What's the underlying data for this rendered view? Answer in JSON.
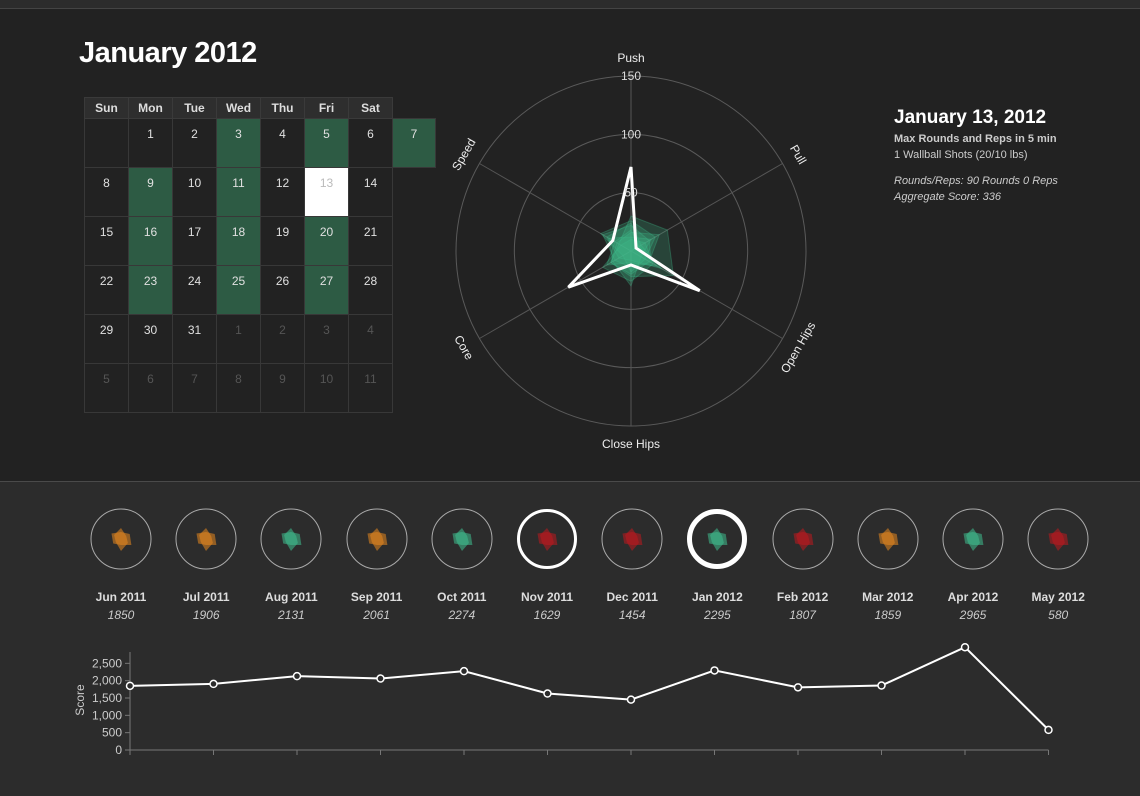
{
  "calendar": {
    "title": "January 2012",
    "weekdays": [
      "Sun",
      "Mon",
      "Tue",
      "Wed",
      "Thu",
      "Fri",
      "Sat"
    ],
    "weeks": [
      [
        {
          "d": "",
          "s": "other"
        },
        {
          "d": "1",
          "s": "normal"
        },
        {
          "d": "2",
          "s": "normal"
        },
        {
          "d": "3",
          "s": "workout"
        },
        {
          "d": "4",
          "s": "normal"
        },
        {
          "d": "5",
          "s": "workout"
        },
        {
          "d": "6",
          "s": "normal"
        },
        {
          "d": "7",
          "s": "workout"
        }
      ],
      [
        {
          "d": "8",
          "s": "normal"
        },
        {
          "d": "9",
          "s": "workout"
        },
        {
          "d": "10",
          "s": "normal"
        },
        {
          "d": "11",
          "s": "workout"
        },
        {
          "d": "12",
          "s": "normal"
        },
        {
          "d": "13",
          "s": "selected"
        },
        {
          "d": "14",
          "s": "normal"
        }
      ],
      [
        {
          "d": "15",
          "s": "normal"
        },
        {
          "d": "16",
          "s": "workout"
        },
        {
          "d": "17",
          "s": "normal"
        },
        {
          "d": "18",
          "s": "workout"
        },
        {
          "d": "19",
          "s": "normal"
        },
        {
          "d": "20",
          "s": "workout"
        },
        {
          "d": "21",
          "s": "normal"
        }
      ],
      [
        {
          "d": "22",
          "s": "normal"
        },
        {
          "d": "23",
          "s": "workout"
        },
        {
          "d": "24",
          "s": "normal"
        },
        {
          "d": "25",
          "s": "workout"
        },
        {
          "d": "26",
          "s": "normal"
        },
        {
          "d": "27",
          "s": "workout"
        },
        {
          "d": "28",
          "s": "normal"
        }
      ],
      [
        {
          "d": "29",
          "s": "normal"
        },
        {
          "d": "30",
          "s": "normal"
        },
        {
          "d": "31",
          "s": "normal"
        },
        {
          "d": "1",
          "s": "other"
        },
        {
          "d": "2",
          "s": "other"
        },
        {
          "d": "3",
          "s": "other"
        },
        {
          "d": "4",
          "s": "other"
        }
      ],
      [
        {
          "d": "5",
          "s": "other"
        },
        {
          "d": "6",
          "s": "other"
        },
        {
          "d": "7",
          "s": "other"
        },
        {
          "d": "8",
          "s": "other"
        },
        {
          "d": "9",
          "s": "other"
        },
        {
          "d": "10",
          "s": "other"
        },
        {
          "d": "11",
          "s": "other"
        }
      ]
    ]
  },
  "detail": {
    "date": "January 13, 2012",
    "wod": "Max Rounds and Reps in 5 min",
    "exercise": "1 Wallball Shots (20/10 lbs)",
    "result": "Rounds/Reps: 90 Rounds 0 Reps",
    "aggregate": "Aggregate Score: 336"
  },
  "chart_data": [
    {
      "type": "radar",
      "axes": [
        "Push",
        "Pull",
        "Open Hips",
        "Close Hips",
        "Core",
        "Speed"
      ],
      "ticks": [
        50,
        100,
        150
      ],
      "max": 150,
      "colors": {
        "workouts": "#3fbf8f",
        "selected": "#ffffff"
      },
      "selected_series": {
        "name": "January 13, 2012",
        "values": [
          72,
          5,
          68,
          12,
          62,
          18
        ]
      },
      "background_series": [
        [
          22,
          18,
          20,
          14,
          16,
          28
        ],
        [
          30,
          36,
          42,
          22,
          20,
          12
        ],
        [
          12,
          20,
          10,
          30,
          18,
          22
        ],
        [
          18,
          8,
          26,
          10,
          24,
          16
        ],
        [
          26,
          24,
          14,
          18,
          8,
          30
        ],
        [
          10,
          14,
          22,
          26,
          28,
          10
        ],
        [
          24,
          10,
          30,
          8,
          12,
          24
        ],
        [
          16,
          28,
          18,
          20,
          20,
          14
        ]
      ]
    },
    {
      "type": "line",
      "title": "",
      "ylabel": "Score",
      "categories": [
        "Jun 2011",
        "Jul 2011",
        "Aug 2011",
        "Sep 2011",
        "Oct 2011",
        "Nov 2011",
        "Dec 2011",
        "Jan 2012",
        "Feb 2012",
        "Mar 2012",
        "Apr 2012",
        "May 2012"
      ],
      "values": [
        1850,
        1906,
        2131,
        2061,
        2274,
        1629,
        1454,
        2295,
        1807,
        1859,
        2965,
        580
      ],
      "ylim": [
        0,
        2500
      ],
      "yticks": [
        0,
        500,
        1000,
        1500,
        2000,
        2500
      ]
    }
  ],
  "months": [
    {
      "label": "Jun 2011",
      "score": "1850",
      "color": "#e8881f",
      "ring": "thin"
    },
    {
      "label": "Jul 2011",
      "score": "1906",
      "color": "#e8881f",
      "ring": "thin"
    },
    {
      "label": "Aug 2011",
      "score": "2131",
      "color": "#3fbf8f",
      "ring": "thin"
    },
    {
      "label": "Sep 2011",
      "score": "2061",
      "color": "#e8881f",
      "ring": "thin"
    },
    {
      "label": "Oct 2011",
      "score": "2274",
      "color": "#3fbf8f",
      "ring": "thin"
    },
    {
      "label": "Nov 2011",
      "score": "1629",
      "color": "#c0191f",
      "ring": "medium"
    },
    {
      "label": "Dec 2011",
      "score": "1454",
      "color": "#c0191f",
      "ring": "thin"
    },
    {
      "label": "Jan 2012",
      "score": "2295",
      "color": "#3fbf8f",
      "ring": "thick"
    },
    {
      "label": "Feb 2012",
      "score": "1807",
      "color": "#c0191f",
      "ring": "thin"
    },
    {
      "label": "Mar 2012",
      "score": "1859",
      "color": "#e8881f",
      "ring": "thin"
    },
    {
      "label": "Apr 2012",
      "score": "2965",
      "color": "#3fbf8f",
      "ring": "thin"
    },
    {
      "label": "May 2012",
      "score": "580",
      "color": "#c0191f",
      "ring": "thin"
    }
  ]
}
